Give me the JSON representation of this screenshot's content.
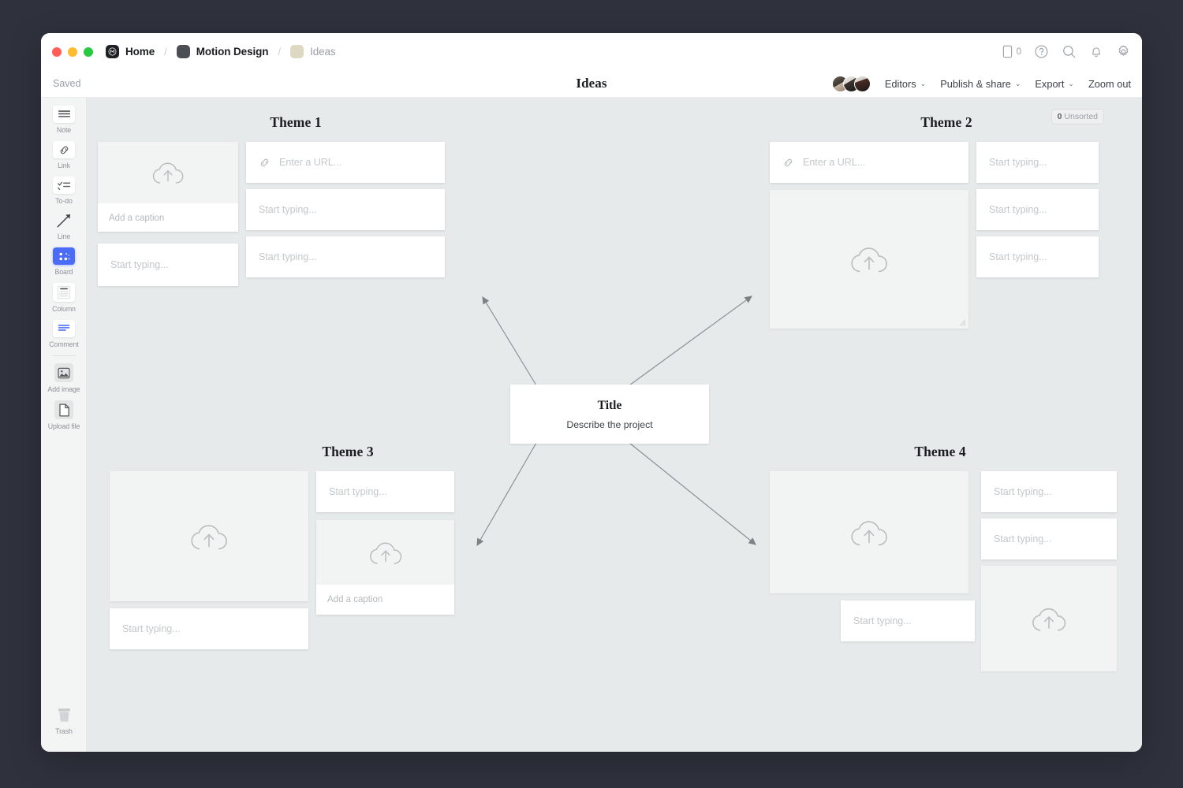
{
  "window": {
    "traffic_lights": [
      "close",
      "minimize",
      "maximize"
    ],
    "breadcrumb": [
      {
        "label": "Home",
        "icon": "milanote-logo-icon",
        "muted": false
      },
      {
        "label": "Motion Design",
        "icon": "folder-grey-icon",
        "muted": false
      },
      {
        "label": "Ideas",
        "icon": "folder-tan-icon",
        "muted": true
      }
    ],
    "separator": "/",
    "right_icons": [
      {
        "name": "mobile-icon",
        "count": "0"
      },
      {
        "name": "help-icon"
      },
      {
        "name": "search-icon"
      },
      {
        "name": "notifications-bell-icon"
      },
      {
        "name": "settings-gear-icon"
      }
    ]
  },
  "subbar": {
    "save_status": "Saved",
    "document_title": "Ideas",
    "editors_label": "Editors",
    "publish_label": "Publish & share",
    "export_label": "Export",
    "zoom_label": "Zoom out",
    "caret": "⌄"
  },
  "sidebar": {
    "tools": [
      {
        "label": "Note",
        "icon": "note-icon"
      },
      {
        "label": "Link",
        "icon": "link-icon"
      },
      {
        "label": "To-do",
        "icon": "todo-icon"
      },
      {
        "label": "Line",
        "icon": "line-arrow-icon"
      },
      {
        "label": "Board",
        "icon": "board-icon"
      },
      {
        "label": "Column",
        "icon": "column-icon"
      },
      {
        "label": "Comment",
        "icon": "comment-icon"
      }
    ],
    "attach_tools": [
      {
        "label": "Add image",
        "icon": "add-image-icon"
      },
      {
        "label": "Upload file",
        "icon": "upload-file-icon"
      }
    ],
    "trash": {
      "label": "Trash",
      "icon": "trash-icon"
    },
    "active_tool": "Board",
    "active_color": "#4a6cf7"
  },
  "canvas": {
    "background_color": "#e7eaea",
    "unsorted_badge": {
      "count": "0",
      "label": "Unsorted"
    },
    "center_card": {
      "title": "Title",
      "subtitle": "Describe the project"
    },
    "themes": [
      {
        "name": "theme-1",
        "label": "Theme 1"
      },
      {
        "name": "theme-2",
        "label": "Theme 2"
      },
      {
        "name": "theme-3",
        "label": "Theme 3"
      },
      {
        "name": "theme-4",
        "label": "Theme 4"
      }
    ],
    "placeholders": {
      "url": "Enter a URL...",
      "note": "Start typing...",
      "caption": "Add a caption"
    },
    "cards": {
      "t1_image_caption": "Add a caption",
      "t1_url": "Enter a URL...",
      "t1_note_a": "Start typing...",
      "t1_note_b": "Start typing...",
      "t1_note_c": "Start typing...",
      "t2_url": "Enter a URL...",
      "t2_note_a": "Start typing...",
      "t2_note_b": "Start typing...",
      "t2_note_c": "Start typing...",
      "t3_note_a": "Start typing...",
      "t3_note_b": "Start typing...",
      "t3_caption": "Add a caption",
      "t4_note_a": "Start typing...",
      "t4_note_b": "Start typing...",
      "t4_note_c": "Start typing..."
    }
  }
}
